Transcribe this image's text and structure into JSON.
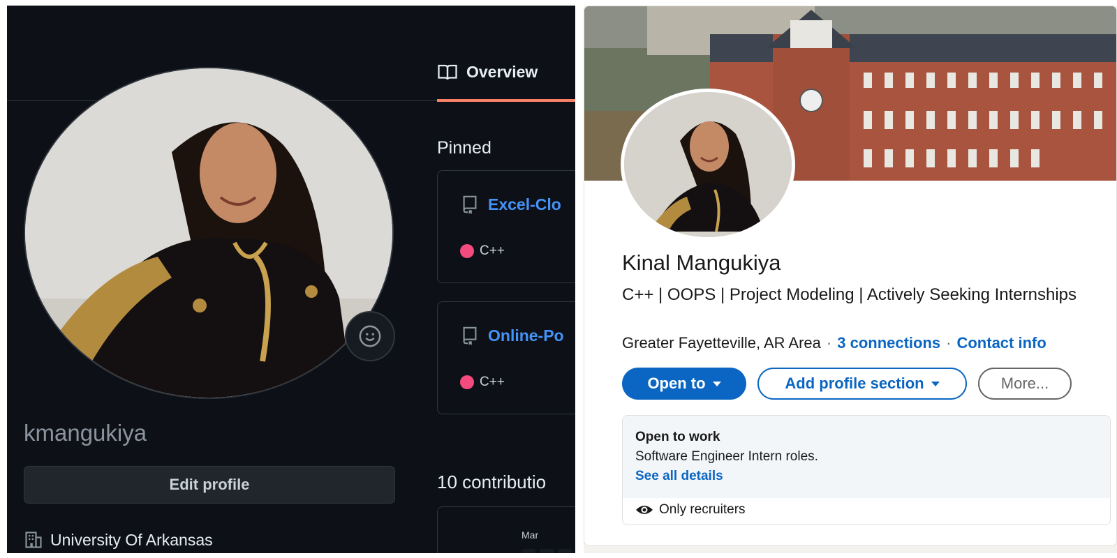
{
  "github": {
    "username": "kmangukiya",
    "edit_profile_label": "Edit profile",
    "organization": "University Of Arkansas",
    "tab_overview_label": "Overview",
    "pinned_heading": "Pinned",
    "pinned_repos": [
      {
        "name": "Excel-Clo",
        "language": "C++",
        "language_color": "#f34b7d"
      },
      {
        "name": "Online-Po",
        "language": "C++",
        "language_color": "#f34b7d"
      }
    ],
    "contributions_heading": "10 contributio",
    "graph_month": "Mar",
    "colors": {
      "background": "#0d1117",
      "accent_underline": "#f78166",
      "link": "#4493f8"
    }
  },
  "linkedin": {
    "name": "Kinal Mangukiya",
    "headline": "C++ | OOPS | Project Modeling | Actively Seeking Internships",
    "location": "Greater Fayetteville, AR Area",
    "connections": "3 connections",
    "contact_info": "Contact info",
    "buttons": {
      "open_to": "Open to",
      "add_section": "Add profile section",
      "more": "More..."
    },
    "open_to_work": {
      "title": "Open to work",
      "roles": "Software Engineer Intern roles.",
      "details_link": "See all details",
      "visibility": "Only recruiters"
    },
    "colors": {
      "brand": "#0a66c2"
    }
  }
}
